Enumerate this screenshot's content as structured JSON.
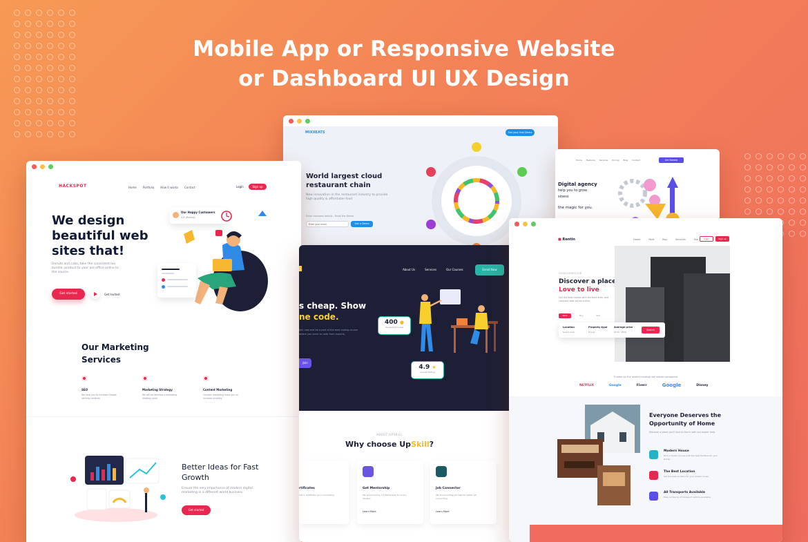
{
  "headline": {
    "line1": "Mobile App or Responsive Website",
    "line2": "or Dashboard UI UX Design"
  },
  "colors": {
    "accent_red": "#e8284e",
    "accent_blue": "#1d8fe6",
    "dark_navy": "#1c1f36",
    "brand_orange": "#f38257"
  },
  "card_hackspot": {
    "logo": "HACKSPOT",
    "nav": [
      "Home",
      "Portfolio",
      "How it works",
      "Contact"
    ],
    "login": "Login",
    "signup": "Sign up",
    "hero_title_1": "We design",
    "hero_title_2": "beautiful web",
    "hero_title_3": "sites that!",
    "hero_sub": "Donuts and cake, take the consistent loa bundle, product to your are office online to the source.",
    "cta": "Get started",
    "watch": "Get invited",
    "happy_customers": "Our Happy Customers",
    "rating": "4.8 (Rating)",
    "section_title_1": "Our Marketing",
    "section_title_2": "Services",
    "services": [
      {
        "title": "SEO",
        "desc": "We help you to increase Google ranking contents",
        "icon": "target-icon"
      },
      {
        "title": "Marketing Strategy",
        "desc": "We will be develop a marketing strategy work",
        "icon": "check-icon"
      },
      {
        "title": "Content Marketing",
        "desc": "Content marketing helps you to increase visibility",
        "icon": "pen-icon"
      }
    ],
    "better_title_1": "Better Ideas for Fast",
    "better_title_2": "Growth",
    "better_desc": "Ensure the very importance of modern digital marketing in a different world business.",
    "better_cta": "Get started"
  },
  "card_cloud": {
    "logo": "MIXXEATS",
    "nav_cta": "Get your free Demo",
    "title_1": "World largest cloud",
    "title_2": "restaurant chain",
    "desc": "New innovation in the restaurant industry to provide high quality & affordable food",
    "email_label": "Enter business details - Book the Demo",
    "email_placeholder": "Enter your email",
    "submit": "Get a Demo"
  },
  "card_agency": {
    "nav": [
      "Home",
      "Features",
      "Services",
      "Pricing",
      "Blog",
      "Contact"
    ],
    "cta": "Get Started",
    "title_1": "Digital agency",
    "title_2": "help you to grow",
    "title_3": "siness",
    "tagline": "the magic for you."
  },
  "card_upskill": {
    "nav": [
      "About Us",
      "Services",
      "Our Courses"
    ],
    "nav_cta": "Enroll Now",
    "hero_1": "s cheap. Show",
    "hero_2": "ne code.",
    "hero_desc": "Join now and be a part of the best coding course where you learn to code from experts.",
    "hero_btn": "Join",
    "stat1_value": "400",
    "stat1_label": "Students Enrolled",
    "stat2_value": "4.9",
    "stat2_label": "Overall Rating",
    "about_kicker": "ABOUT UPSKILL",
    "why_prefix": "Why choose Up",
    "why_brand": "Skill",
    "why_suffix": "?",
    "features": [
      {
        "title": "rtificates",
        "desc": "Get a certificate upon completing",
        "link": ""
      },
      {
        "title": "Get Mentorship",
        "desc": "We are providing 1:1 Mentorship for every student",
        "link": "Learn More"
      },
      {
        "title": "Job Connector",
        "desc": "We are providing job help for better job connecting",
        "link": "Learn More"
      }
    ]
  },
  "card_estate": {
    "logo": "Rentin",
    "nav": [
      "Home",
      "Rent",
      "Buy",
      "Services",
      "Faq"
    ],
    "login": "Login",
    "signup": "Sign up",
    "kicker": "GOOD HOMES FOR",
    "hero_1": "Discover a place you'll",
    "hero_2": "Love to live",
    "hero_desc": "Get the best homes with the best area, and compare best prices online.",
    "tabs": [
      "Rent",
      "Buy",
      "Sell"
    ],
    "search_fields": [
      {
        "label": "Location",
        "value": "Select area"
      },
      {
        "label": "Property type",
        "value": "House"
      },
      {
        "label": "Average price",
        "value": "$150 - $500"
      }
    ],
    "search_btn": "Search",
    "trusted": "Trusted by the world's leading real estate companies",
    "brands": [
      "NETFLIX",
      "Google",
      "Fiverr",
      "Google",
      "Disney"
    ],
    "opp_1": "Everyone Deserves the",
    "opp_2": "Opportunity of Home",
    "opp_desc": "Discover a place you'll love to live in with our expert help.",
    "features": [
      {
        "title": "Modern House",
        "desc": "Find a modern house with the best facilities for your family"
      },
      {
        "title": "The Best Location",
        "desc": "Get the best location for your dream house"
      },
      {
        "title": "All Transports Available",
        "desc": "Easy access to all transport options available"
      }
    ]
  }
}
